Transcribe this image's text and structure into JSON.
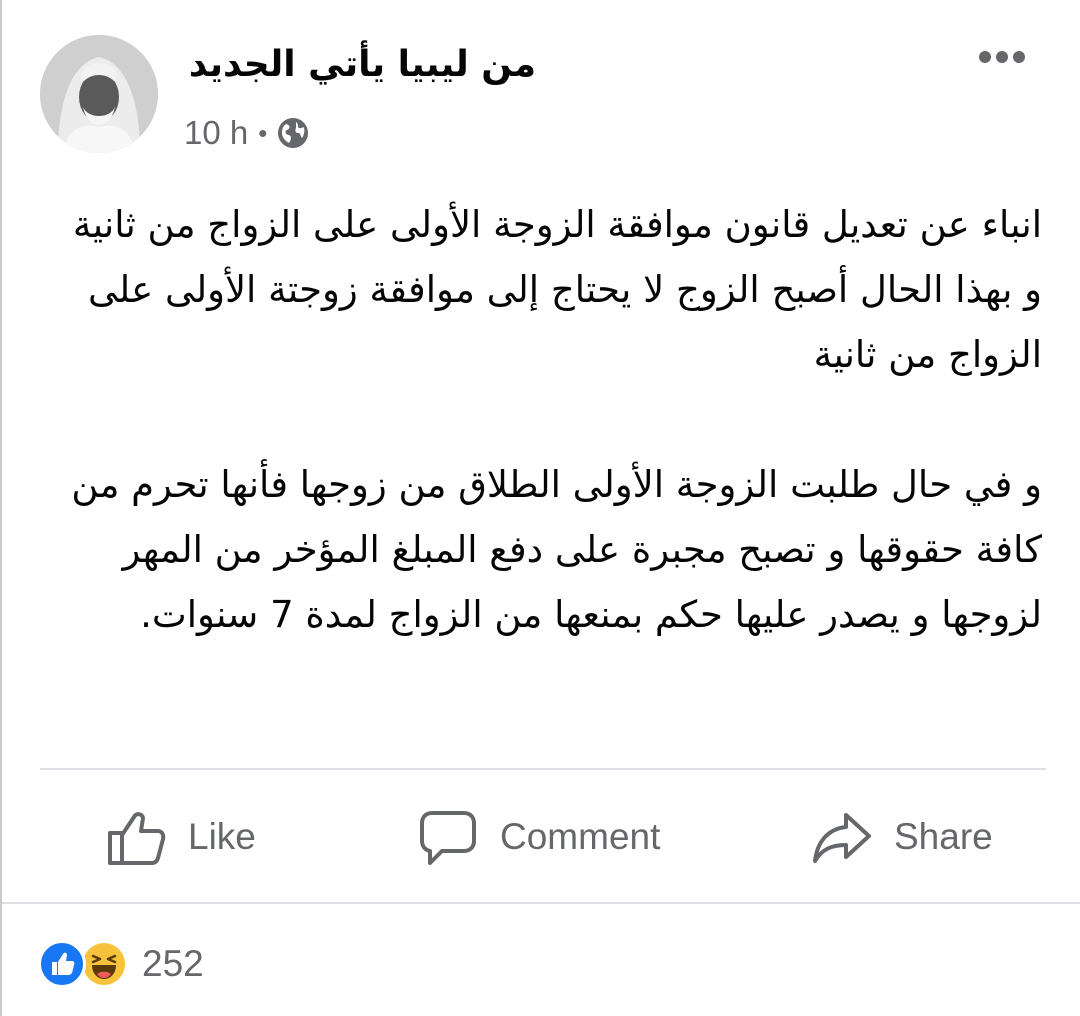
{
  "post": {
    "author": "من ليبيا يأتي الجديد",
    "time": "10 h",
    "separator": "•",
    "privacy_icon": "globe-icon",
    "menu_icon": "more-dots-icon",
    "paragraphs": [
      "انباء عن تعديل قانون موافقة الزوجة الأولى على الزواج من ثانية و بهذا الحال أصبح الزوج لا يحتاج إلى موافقة زوجتة الأولى على الزواج من ثانية",
      "و في حال طلبت الزوجة الأولى الطلاق من زوجها فأنها تحرم من كافة حقوقها و تصبح مجبرة على دفع المبلغ المؤخر من المهر لزوجها و يصدر عليها حكم بمنعها من الزواج لمدة 7 سنوات."
    ]
  },
  "actions": {
    "like": "Like",
    "comment": "Comment",
    "share": "Share"
  },
  "reactions": {
    "icons": [
      "like-reaction-icon",
      "haha-reaction-icon"
    ],
    "count": "252"
  },
  "colors": {
    "text": "#050505",
    "secondary": "#65676b",
    "like_blue": "#1877f2",
    "haha_yellow": "#f7c33c",
    "divider": "#dddfe2"
  }
}
